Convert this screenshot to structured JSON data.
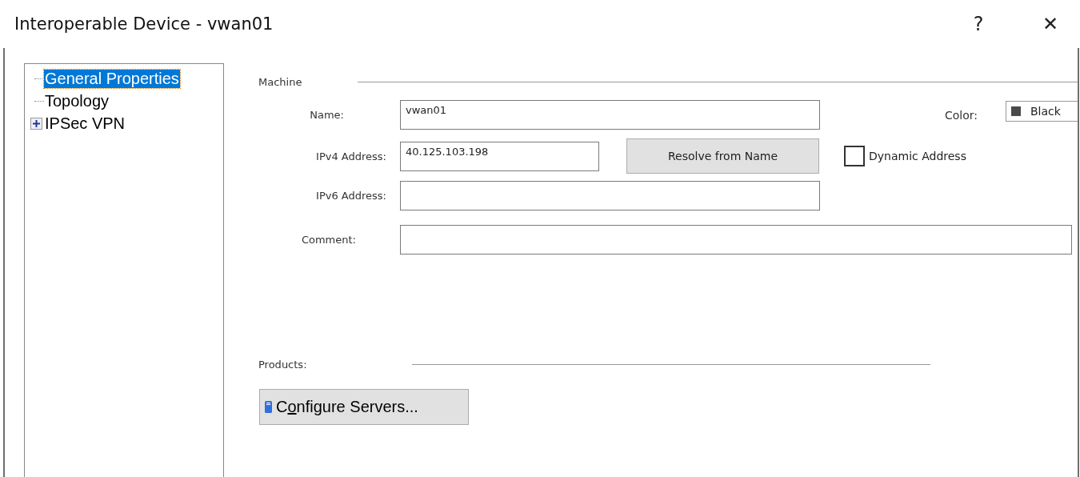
{
  "window": {
    "title": "Interoperable Device - vwan01",
    "help": "?",
    "close": "✕"
  },
  "tree": [
    {
      "label": "General Properties",
      "selected": true
    },
    {
      "label": "Topology",
      "selected": false
    },
    {
      "label": "IPSec VPN",
      "selected": false,
      "expanded": false
    }
  ],
  "machine": {
    "heading": "Machine",
    "name": {
      "label": "Name:",
      "value": "vwan01"
    },
    "color": {
      "label": "Color:",
      "value": "Black"
    },
    "ipv4": {
      "label": "IPv4 Address:",
      "value": "40.125.103.198"
    },
    "resolve_button": "Resolve from Name",
    "dynamic_address": {
      "label": "Dynamic Address",
      "checked": false
    },
    "ipv6": {
      "label": "IPv6 Address:"
    },
    "comment": {
      "label": "Comment:"
    }
  },
  "products": {
    "heading": "Products:",
    "button": {
      "before": "C",
      "mnemonic": "o",
      "after": "nfigure Servers..."
    }
  }
}
